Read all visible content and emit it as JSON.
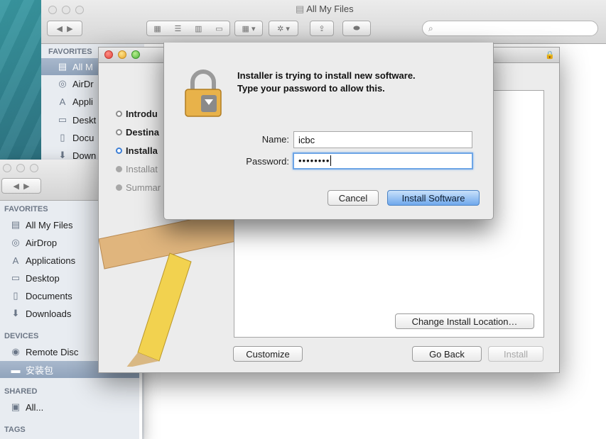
{
  "finder_back": {
    "title": "All My Files",
    "search_placeholder": "",
    "sidebar": {
      "section": "FAVORITES",
      "items": [
        {
          "label": "All M",
          "icon": "all-files-icon",
          "selected": true
        },
        {
          "label": "AirDr",
          "icon": "airdrop-icon"
        },
        {
          "label": "Appli",
          "icon": "applications-icon"
        },
        {
          "label": "Deskt",
          "icon": "desktop-icon"
        },
        {
          "label": "Docu",
          "icon": "documents-icon"
        },
        {
          "label": "Down",
          "icon": "downloads-icon"
        }
      ]
    }
  },
  "finder_front": {
    "sidebar": {
      "favorites_header": "FAVORITES",
      "favorites": [
        "All My Files",
        "AirDrop",
        "Applications",
        "Desktop",
        "Documents",
        "Downloads"
      ],
      "devices_header": "DEVICES",
      "devices": [
        "Remote Disc",
        "安装包"
      ],
      "shared_header": "SHARED",
      "shared": [
        "All..."
      ],
      "tags_header": "TAGS"
    }
  },
  "installer": {
    "steps": [
      {
        "label": "Introdu",
        "state": "done"
      },
      {
        "label": "Destina",
        "state": "done"
      },
      {
        "label": "Installa",
        "state": "current"
      },
      {
        "label": "Installat",
        "state": "pending"
      },
      {
        "label": "Summar",
        "state": "pending"
      }
    ],
    "buttons": {
      "change_location": "Change Install Location…",
      "customize": "Customize",
      "go_back": "Go Back",
      "install": "Install"
    }
  },
  "auth_dialog": {
    "message_line1": "Installer is trying to install new software.",
    "message_line2": "Type your password to allow this.",
    "name_label": "Name:",
    "name_value": "icbc",
    "password_label": "Password:",
    "password_value": "••••••••",
    "cancel": "Cancel",
    "install_software": "Install Software"
  },
  "colors": {
    "default_button": "#6fa8ec",
    "focus_ring": "#6da5e6",
    "sidebar_bg": "#e8ecf1"
  }
}
